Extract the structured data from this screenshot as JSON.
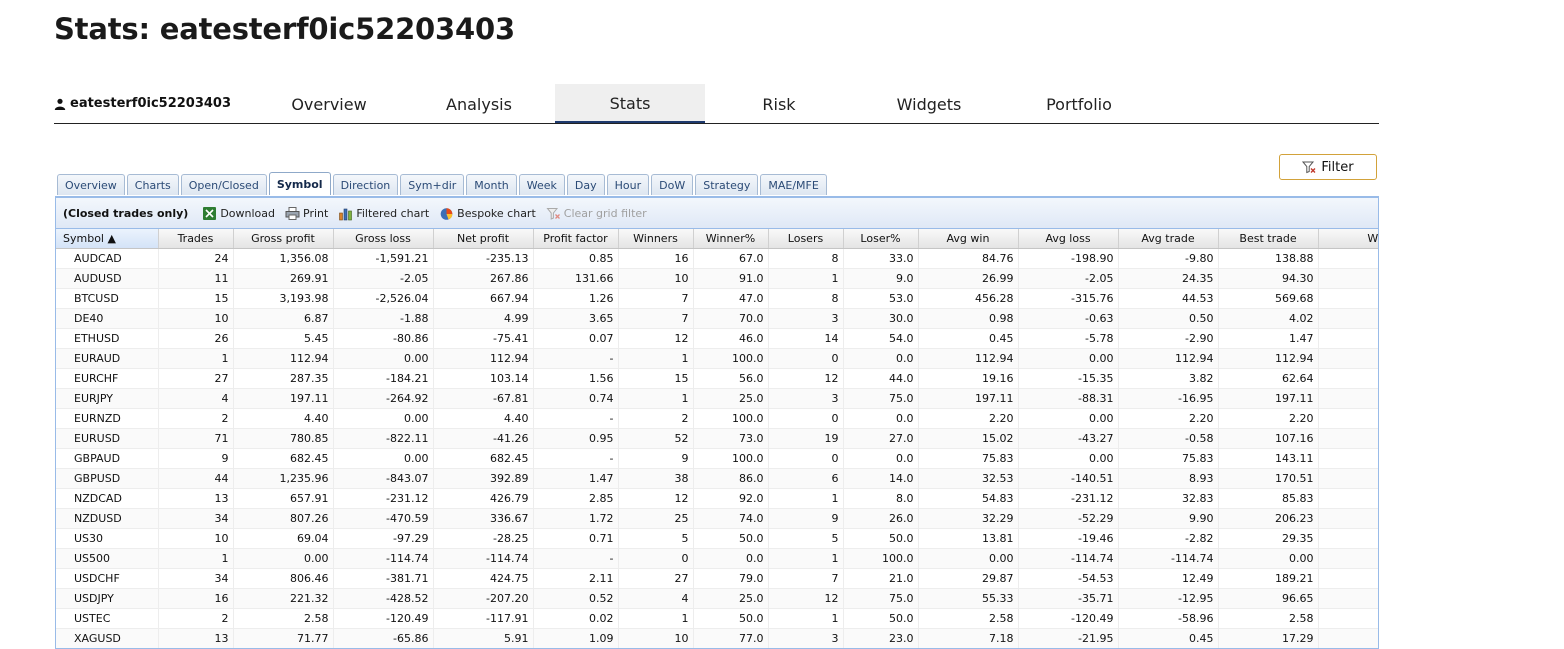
{
  "page": {
    "title": "Stats: eatesterf0ic52203403"
  },
  "account": {
    "name": "eatesterf0ic52203403"
  },
  "nav": {
    "tabs": [
      {
        "label": "Overview"
      },
      {
        "label": "Analysis"
      },
      {
        "label": "Stats"
      },
      {
        "label": "Risk"
      },
      {
        "label": "Widgets"
      },
      {
        "label": "Portfolio"
      }
    ],
    "active": "Stats"
  },
  "filter": {
    "label": "Filter"
  },
  "subtabs": {
    "items": [
      "Overview",
      "Charts",
      "Open/Closed",
      "Symbol",
      "Direction",
      "Sym+dir",
      "Month",
      "Week",
      "Day",
      "Hour",
      "DoW",
      "Strategy",
      "MAE/MFE"
    ],
    "active": "Symbol"
  },
  "toolbar": {
    "note": "(Closed trades only)",
    "download": "Download",
    "print": "Print",
    "filtered_chart": "Filtered chart",
    "bespoke_chart": "Bespoke chart",
    "clear_filter": "Clear grid filter"
  },
  "grid": {
    "columns": [
      "Symbol ▲",
      "Trades",
      "Gross profit",
      "Gross loss",
      "Net profit",
      "Profit factor",
      "Winners",
      "Winner%",
      "Losers",
      "Loser%",
      "Avg win",
      "Avg loss",
      "Avg trade",
      "Best trade",
      "Worst t"
    ],
    "rows": [
      [
        "AUDCAD",
        "24",
        "1,356.08",
        "-1,591.21",
        "-235.13",
        "0.85",
        "16",
        "67.0",
        "8",
        "33.0",
        "84.76",
        "-198.90",
        "-9.80",
        "138.88",
        ""
      ],
      [
        "AUDUSD",
        "11",
        "269.91",
        "-2.05",
        "267.86",
        "131.66",
        "10",
        "91.0",
        "1",
        "9.0",
        "26.99",
        "-2.05",
        "24.35",
        "94.30",
        ""
      ],
      [
        "BTCUSD",
        "15",
        "3,193.98",
        "-2,526.04",
        "667.94",
        "1.26",
        "7",
        "47.0",
        "8",
        "53.0",
        "456.28",
        "-315.76",
        "44.53",
        "569.68",
        ""
      ],
      [
        "DE40",
        "10",
        "6.87",
        "-1.88",
        "4.99",
        "3.65",
        "7",
        "70.0",
        "3",
        "30.0",
        "0.98",
        "-0.63",
        "0.50",
        "4.02",
        ""
      ],
      [
        "ETHUSD",
        "26",
        "5.45",
        "-80.86",
        "-75.41",
        "0.07",
        "12",
        "46.0",
        "14",
        "54.0",
        "0.45",
        "-5.78",
        "-2.90",
        "1.47",
        ""
      ],
      [
        "EURAUD",
        "1",
        "112.94",
        "0.00",
        "112.94",
        "-",
        "1",
        "100.0",
        "0",
        "0.0",
        "112.94",
        "0.00",
        "112.94",
        "112.94",
        ""
      ],
      [
        "EURCHF",
        "27",
        "287.35",
        "-184.21",
        "103.14",
        "1.56",
        "15",
        "56.0",
        "12",
        "44.0",
        "19.16",
        "-15.35",
        "3.82",
        "62.64",
        ""
      ],
      [
        "EURJPY",
        "4",
        "197.11",
        "-264.92",
        "-67.81",
        "0.74",
        "1",
        "25.0",
        "3",
        "75.0",
        "197.11",
        "-88.31",
        "-16.95",
        "197.11",
        ""
      ],
      [
        "EURNZD",
        "2",
        "4.40",
        "0.00",
        "4.40",
        "-",
        "2",
        "100.0",
        "0",
        "0.0",
        "2.20",
        "0.00",
        "2.20",
        "2.20",
        ""
      ],
      [
        "EURUSD",
        "71",
        "780.85",
        "-822.11",
        "-41.26",
        "0.95",
        "52",
        "73.0",
        "19",
        "27.0",
        "15.02",
        "-43.27",
        "-0.58",
        "107.16",
        ""
      ],
      [
        "GBPAUD",
        "9",
        "682.45",
        "0.00",
        "682.45",
        "-",
        "9",
        "100.0",
        "0",
        "0.0",
        "75.83",
        "0.00",
        "75.83",
        "143.11",
        ""
      ],
      [
        "GBPUSD",
        "44",
        "1,235.96",
        "-843.07",
        "392.89",
        "1.47",
        "38",
        "86.0",
        "6",
        "14.0",
        "32.53",
        "-140.51",
        "8.93",
        "170.51",
        ""
      ],
      [
        "NZDCAD",
        "13",
        "657.91",
        "-231.12",
        "426.79",
        "2.85",
        "12",
        "92.0",
        "1",
        "8.0",
        "54.83",
        "-231.12",
        "32.83",
        "85.83",
        ""
      ],
      [
        "NZDUSD",
        "34",
        "807.26",
        "-470.59",
        "336.67",
        "1.72",
        "25",
        "74.0",
        "9",
        "26.0",
        "32.29",
        "-52.29",
        "9.90",
        "206.23",
        ""
      ],
      [
        "US30",
        "10",
        "69.04",
        "-97.29",
        "-28.25",
        "0.71",
        "5",
        "50.0",
        "5",
        "50.0",
        "13.81",
        "-19.46",
        "-2.82",
        "29.35",
        ""
      ],
      [
        "US500",
        "1",
        "0.00",
        "-114.74",
        "-114.74",
        "-",
        "0",
        "0.0",
        "1",
        "100.0",
        "0.00",
        "-114.74",
        "-114.74",
        "0.00",
        ""
      ],
      [
        "USDCHF",
        "34",
        "806.46",
        "-381.71",
        "424.75",
        "2.11",
        "27",
        "79.0",
        "7",
        "21.0",
        "29.87",
        "-54.53",
        "12.49",
        "189.21",
        ""
      ],
      [
        "USDJPY",
        "16",
        "221.32",
        "-428.52",
        "-207.20",
        "0.52",
        "4",
        "25.0",
        "12",
        "75.0",
        "55.33",
        "-35.71",
        "-12.95",
        "96.65",
        ""
      ],
      [
        "USTEC",
        "2",
        "2.58",
        "-120.49",
        "-117.91",
        "0.02",
        "1",
        "50.0",
        "1",
        "50.0",
        "2.58",
        "-120.49",
        "-58.96",
        "2.58",
        ""
      ],
      [
        "XAGUSD",
        "13",
        "71.77",
        "-65.86",
        "5.91",
        "1.09",
        "10",
        "77.0",
        "3",
        "23.0",
        "7.18",
        "-21.95",
        "0.45",
        "17.29",
        ""
      ]
    ]
  }
}
